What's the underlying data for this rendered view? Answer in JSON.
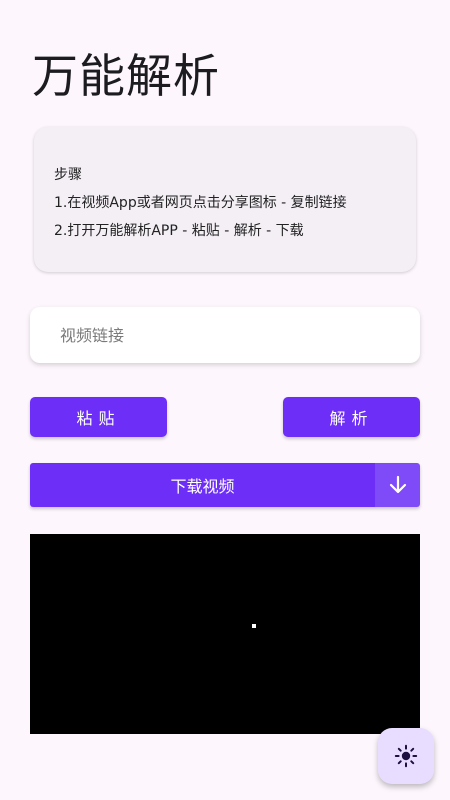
{
  "app": {
    "title": "万能解析"
  },
  "steps": {
    "heading": "步骤",
    "line1": "1.在视频App或者网页点击分享图标 - 复制链接",
    "line2": "2.打开万能解析APP - 粘贴 - 解析 - 下载"
  },
  "input": {
    "placeholder": "视频链接",
    "value": ""
  },
  "buttons": {
    "paste": "粘贴",
    "parse": "解析",
    "download": "下载视频"
  },
  "icons": {
    "download": "arrow-down-icon",
    "fab": "brightness-icon"
  },
  "colors": {
    "accent": "#6d2ef8",
    "fab_bg": "#e9ddff",
    "background": "#fdf7fd"
  }
}
